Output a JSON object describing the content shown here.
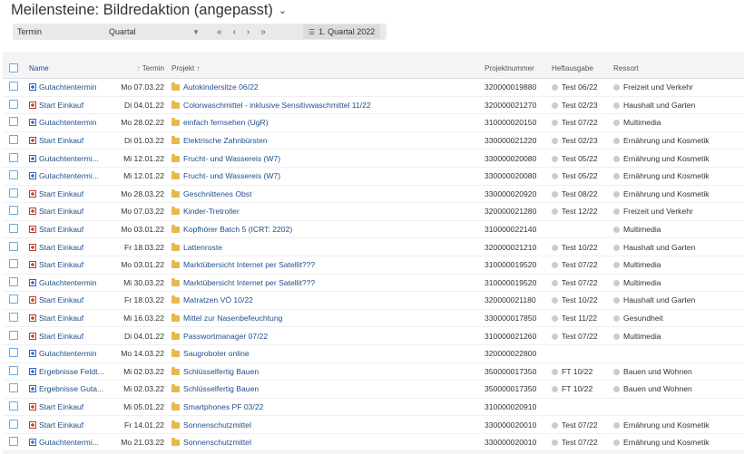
{
  "title": "Meilensteine: Bildredaktion (angepasst)",
  "toolbar": {
    "field_label": "Termin",
    "select_value": "Quartal",
    "period_label": "1. Quartal 2022"
  },
  "columns": {
    "name": "Name",
    "termin": "Termin",
    "projekt": "Projekt",
    "projektnummer": "Projektnummer",
    "heftausgabe": "Heftausgabe",
    "ressort": "Ressort"
  },
  "colors": {
    "accent": "#1f4e8c",
    "folder": "#e8b84a",
    "start_icon": "#c0392b",
    "gutachten_icon": "#2b64c0"
  },
  "rows": [
    {
      "name": "Gutachtentermin",
      "type": "gutachten",
      "date": "Mo 07.03.22",
      "project": "Autokindersitze 06/22",
      "nr": "320000019880",
      "heft": "Test 06/22",
      "ressort": "Freizeit und Verkehr"
    },
    {
      "name": "Start Einkauf",
      "type": "start",
      "date": "Di 04.01.22",
      "project": "Colorwaschmittel - inklusive Sensitivwaschmittel 11/22",
      "nr": "320000021270",
      "heft": "Test 02/23",
      "ressort": "Haushalt und Garten"
    },
    {
      "name": "Gutachtentermin",
      "type": "gutachten",
      "date": "Mo 28.02.22",
      "project": "einfach fernsehen (UgR)",
      "nr": "310000020150",
      "heft": "Test 07/22",
      "ressort": "Multimedia"
    },
    {
      "name": "Start Einkauf",
      "type": "start",
      "date": "Di 01.03.22",
      "project": "Elektrische Zahnbürsten",
      "nr": "330000021220",
      "heft": "Test 02/23",
      "ressort": "Ernährung und Kosmetik"
    },
    {
      "name": "Gutachtentermi...",
      "type": "gutachten",
      "date": "Mi 12.01.22",
      "project": "Frucht- und Wassereis (W7)",
      "nr": "330000020080",
      "heft": "Test 05/22",
      "ressort": "Ernährung und Kosmetik"
    },
    {
      "name": "Gutachtentermi...",
      "type": "gutachten",
      "date": "Mi 12.01.22",
      "project": "Frucht- und Wassereis (W7)",
      "nr": "330000020080",
      "heft": "Test 05/22",
      "ressort": "Ernährung und Kosmetik"
    },
    {
      "name": "Start Einkauf",
      "type": "start",
      "date": "Mo 28.03.22",
      "project": "Geschnittenes Obst",
      "nr": "330000020920",
      "heft": "Test 08/22",
      "ressort": "Ernährung und Kosmetik"
    },
    {
      "name": "Start Einkauf",
      "type": "start",
      "date": "Mo 07.03.22",
      "project": "Kinder-Tretroller",
      "nr": "320000021280",
      "heft": "Test 12/22",
      "ressort": "Freizeit und Verkehr"
    },
    {
      "name": "Start Einkauf",
      "type": "start",
      "date": "Mo 03.01.22",
      "project": "Kopfhörer Batch 5 (ICRT: 2202)",
      "nr": "310000022140",
      "heft": "",
      "ressort": "Multimedia"
    },
    {
      "name": "Start Einkauf",
      "type": "start",
      "date": "Fr 18.03.22",
      "project": "Lattenroste",
      "nr": "320000021210",
      "heft": "Test 10/22",
      "ressort": "Haushalt und Garten"
    },
    {
      "name": "Start Einkauf",
      "type": "start",
      "date": "Mo 03.01.22",
      "project": "Marktübersicht Internet per Satellit???",
      "nr": "310000019520",
      "heft": "Test 07/22",
      "ressort": "Multimedia"
    },
    {
      "name": "Gutachtentermin",
      "type": "gutachten",
      "date": "Mi 30.03.22",
      "project": "Marktübersicht Internet per Satellit???",
      "nr": "310000019520",
      "heft": "Test 07/22",
      "ressort": "Multimedia"
    },
    {
      "name": "Start Einkauf",
      "type": "start",
      "date": "Fr 18.03.22",
      "project": "Matratzen VÖ 10/22",
      "nr": "320000021180",
      "heft": "Test 10/22",
      "ressort": "Haushalt und Garten"
    },
    {
      "name": "Start Einkauf",
      "type": "start",
      "date": "Mi 16.03.22",
      "project": "Mittel zur Nasenbefeuchtung",
      "nr": "330000017850",
      "heft": "Test 11/22",
      "ressort": "Gesundheit"
    },
    {
      "name": "Start Einkauf",
      "type": "start",
      "date": "Di 04.01.22",
      "project": "Passwortmanager 07/22",
      "nr": "310000021260",
      "heft": "Test 07/22",
      "ressort": "Multimedia"
    },
    {
      "name": "Gutachtentermin",
      "type": "gutachten",
      "date": "Mo 14.03.22",
      "project": "Saugroboter online",
      "nr": "320000022800",
      "heft": "",
      "ressort": ""
    },
    {
      "name": "Ergebnisse Feldt...",
      "type": "gutachten",
      "date": "Mi 02.03.22",
      "project": "Schlüsselfertig Bauen",
      "nr": "350000017350",
      "heft": "FT 10/22",
      "ressort": "Bauen und Wohnen"
    },
    {
      "name": "Ergebnisse Guta...",
      "type": "gutachten",
      "date": "Mi 02.03.22",
      "project": "Schlüsselfertig Bauen",
      "nr": "350000017350",
      "heft": "FT 10/22",
      "ressort": "Bauen und Wohnen"
    },
    {
      "name": "Start Einkauf",
      "type": "start",
      "date": "Mi 05.01.22",
      "project": "Smartphones PF 03/22",
      "nr": "310000020910",
      "heft": "",
      "ressort": ""
    },
    {
      "name": "Start Einkauf",
      "type": "start",
      "date": "Fr 14.01.22",
      "project": "Sonnenschutzmittel",
      "nr": "330000020010",
      "heft": "Test 07/22",
      "ressort": "Ernährung und Kosmetik"
    },
    {
      "name": "Gutachtentermi...",
      "type": "gutachten",
      "date": "Mo 21.03.22",
      "project": "Sonnenschutzmittel",
      "nr": "330000020010",
      "heft": "Test 07/22",
      "ressort": "Ernährung und Kosmetik"
    }
  ]
}
